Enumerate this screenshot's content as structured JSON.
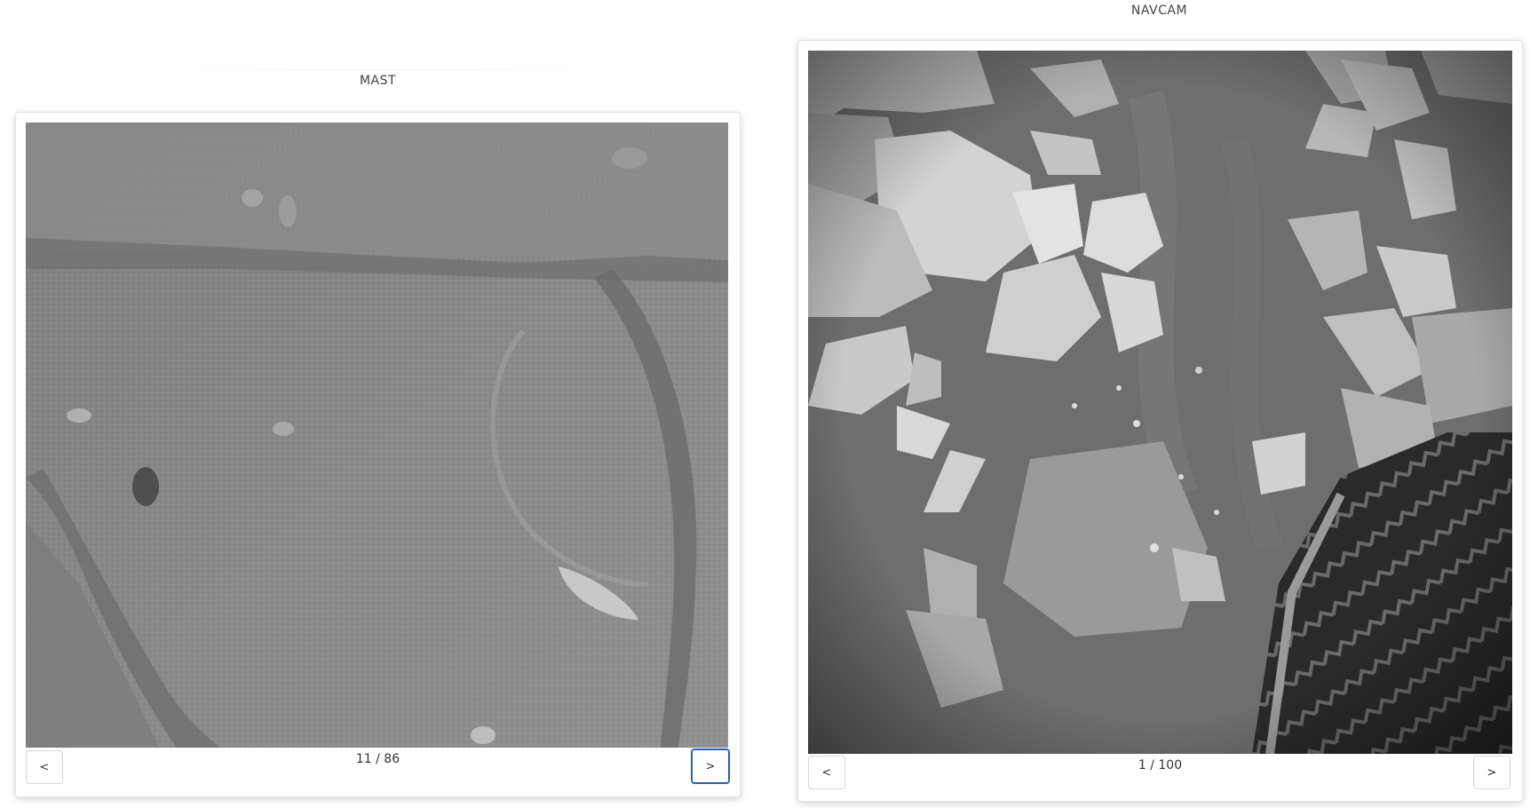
{
  "mast": {
    "title": "MAST",
    "counter": "11 / 86",
    "prev_label": "<",
    "next_label": ">",
    "image_alt": "Mast camera grayscale image of layered bedrock"
  },
  "navcam": {
    "title": "NAVCAM",
    "counter": "1 / 100",
    "prev_label": "<",
    "next_label": ">",
    "image_alt": "Navigation camera grayscale image of broken rock plates and rover wheel"
  }
}
